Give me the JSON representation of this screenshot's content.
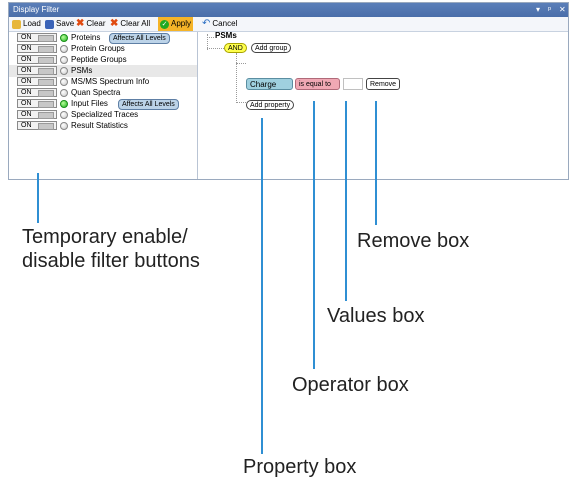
{
  "window": {
    "title": "Display Filter",
    "controls": [
      "▾",
      "ᵖ",
      "✕"
    ]
  },
  "toolbar": {
    "load": "Load",
    "save": "Save",
    "clear": "Clear",
    "clear_all": "Clear All",
    "apply": "Apply",
    "cancel": "Cancel"
  },
  "filters": [
    {
      "toggle": "ON",
      "label": "Proteins",
      "active": true,
      "badge": "Affects All Levels"
    },
    {
      "toggle": "ON",
      "label": "Protein Groups",
      "active": false
    },
    {
      "toggle": "ON",
      "label": "Peptide Groups",
      "active": false
    },
    {
      "toggle": "ON",
      "label": "PSMs",
      "active": false,
      "selected": true
    },
    {
      "toggle": "ON",
      "label": "MS/MS Spectrum Info",
      "active": false
    },
    {
      "toggle": "ON",
      "label": "Quan Spectra",
      "active": false
    },
    {
      "toggle": "ON",
      "label": "Input Files",
      "active": true,
      "badge": "Affects All Levels"
    },
    {
      "toggle": "ON",
      "label": "Specialized Traces",
      "active": false
    },
    {
      "toggle": "ON",
      "label": "Result Statistics",
      "active": false
    }
  ],
  "tree": {
    "root": "PSMs",
    "logic": "AND",
    "add_group": "Add group",
    "property": "Charge",
    "operator": "is equal to",
    "value": "",
    "remove": "Remove",
    "add_property": "Add property"
  },
  "colors": {
    "apply_bg": "#f5b428",
    "and_bg": "#ffff4d",
    "property_bg": "#9fd0df",
    "operator_bg": "#f0a8b4",
    "callout_line": "#2f8fd3"
  },
  "callouts": {
    "toggle": [
      "Temporary enable/",
      "disable filter buttons"
    ],
    "remove": "Remove box",
    "values": "Values box",
    "operator": "Operator box",
    "property": "Property box"
  }
}
